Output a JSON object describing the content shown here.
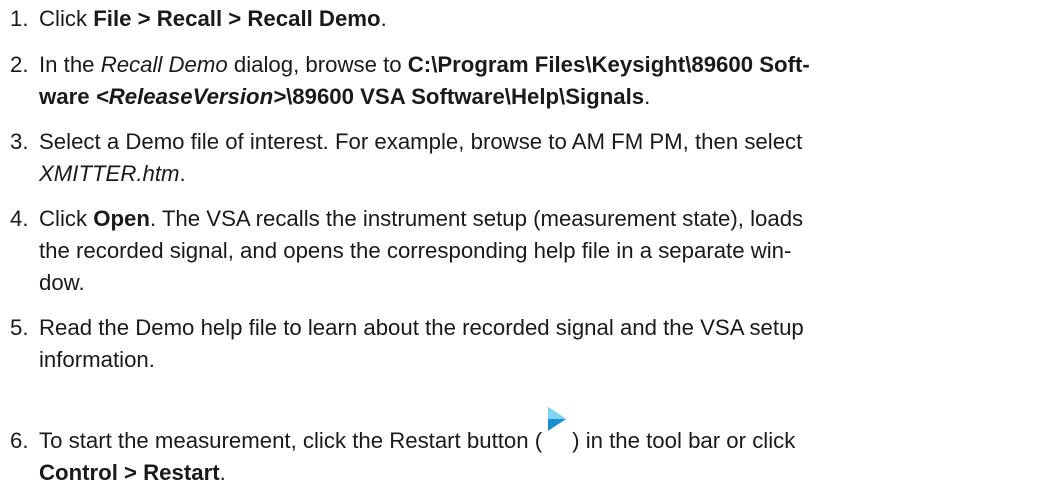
{
  "steps": [
    {
      "number": "1.",
      "p1": "Click ",
      "menu_path": "File > Recall > Recall Demo",
      "p2": "."
    },
    {
      "number": "2.",
      "p1": "In the ",
      "dialog_name": "Recall Demo",
      "p2": " dialog, browse to ",
      "path_part1": "C:\\Program Files\\Keysight\\89600 Soft-",
      "path_part2": "ware ",
      "path_release": "<ReleaseVersion>",
      "path_part3": "\\89600 VSA Software\\Help\\Signals",
      "p3": "."
    },
    {
      "number": "3.",
      "line1": "Select a Demo file of interest. For example, browse to AM FM PM, then select",
      "file_name": "XMITTER.htm",
      "p2": "."
    },
    {
      "number": "4.",
      "p1": "Click ",
      "button_name": "Open",
      "line1_rest": ". The VSA recalls the instrument setup (measurement state), loads",
      "line2": "the recorded signal, and opens the corresponding help file in a separate win-",
      "line3": "dow."
    },
    {
      "number": "5.",
      "line1": "Read the Demo help file to learn about the recorded signal and the VSA setup",
      "line2": "information."
    },
    {
      "number": "6.",
      "p1": "To start the measurement, click the Restart button (",
      "icon": "restart-play-icon",
      "p2": ") in the tool bar or click",
      "menu_path": "Control > Restart",
      "p3": "."
    }
  ],
  "colors": {
    "text": "#1a1a1a",
    "icon_light": "#7fd3f4",
    "icon_dark": "#1a8fd0"
  }
}
